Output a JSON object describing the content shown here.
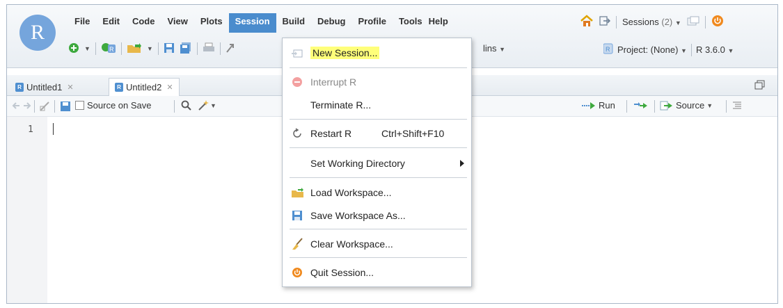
{
  "logo": {
    "letter": "R"
  },
  "menu": [
    "File",
    "Edit",
    "Code",
    "View",
    "Plots",
    "Session",
    "Build",
    "Debug",
    "Profile",
    "Tools",
    "Help"
  ],
  "active_menu": "Session",
  "topright": {
    "sessions_label": "Sessions",
    "sessions_count": "(2)"
  },
  "toolbar": {
    "addins_label": "lins"
  },
  "project": {
    "label": "Project: (None)",
    "r_version": "R 3.6.0"
  },
  "tabs": [
    {
      "label": "Untitled1"
    },
    {
      "label": "Untitled2"
    }
  ],
  "editor": {
    "source_on_save": "Source on Save",
    "run_label": "Run",
    "source_label": "Source",
    "line_number": "1"
  },
  "dropdown": {
    "items": [
      {
        "label": "New Session...",
        "icon": "new-session-icon",
        "highlighted": true
      },
      {
        "label": "Interrupt R",
        "icon": "stop-icon",
        "disabled": true
      },
      {
        "label": "Terminate R..."
      },
      {
        "label": "Restart R",
        "shortcut": "Ctrl+Shift+F10",
        "icon": "restart-icon"
      },
      {
        "label": "Set Working Directory",
        "submenu": true
      },
      {
        "label": "Load Workspace...",
        "icon": "load-folder-icon"
      },
      {
        "label": "Save Workspace As...",
        "icon": "save-disk-icon"
      },
      {
        "label": "Clear Workspace...",
        "icon": "broom-icon"
      },
      {
        "label": "Quit Session...",
        "icon": "power-icon"
      }
    ]
  },
  "colors": {
    "menu_active": "#4a8ccd",
    "highlight": "#ffff7a",
    "logo": "#75a5dc"
  }
}
